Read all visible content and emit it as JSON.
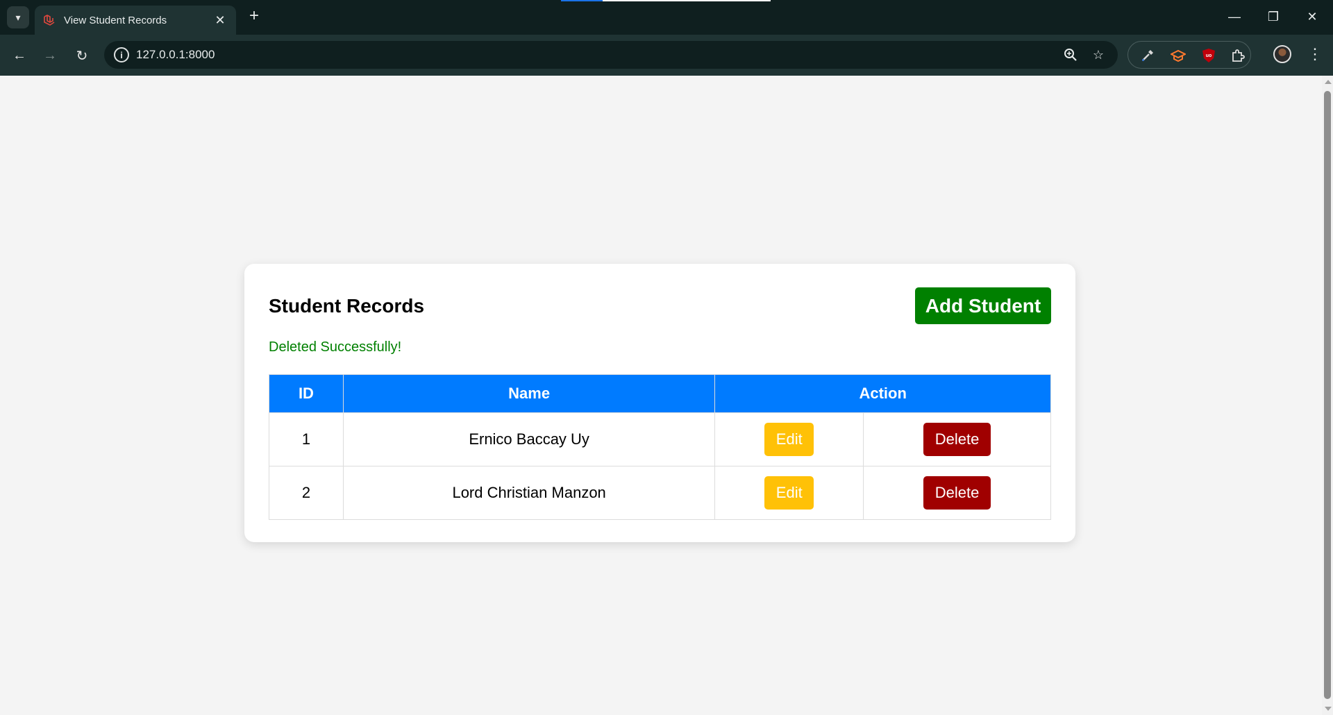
{
  "browser": {
    "tab_title": "View Student Records",
    "url": "127.0.0.1:8000",
    "icons": {
      "tab_search": "chevron-down-icon",
      "favicon": "laravel-icon",
      "tab_close": "close-icon",
      "new_tab": "plus-icon",
      "back": "arrow-left-icon",
      "forward": "arrow-right-icon",
      "reload": "reload-icon",
      "site_info": "info-icon",
      "zoom": "zoom-icon",
      "bookmark": "star-icon",
      "extensions": [
        "eyedropper-icon",
        "graduation-cap-icon",
        "ublock-icon",
        "puzzle-icon"
      ],
      "menu": "more-vertical-icon"
    }
  },
  "page": {
    "title": "Student Records",
    "add_button": "Add Student",
    "flash_message": "Deleted Successfully!",
    "colors": {
      "primary_header": "#007bff",
      "add_button": "#008000",
      "success_text": "#008000",
      "edit_button": "#ffc107",
      "delete_button": "#a00000"
    },
    "table": {
      "headers": [
        "ID",
        "Name",
        "Action"
      ],
      "rows": [
        {
          "id": "1",
          "name": "Ernico Baccay Uy",
          "edit": "Edit",
          "delete": "Delete"
        },
        {
          "id": "2",
          "name": "Lord Christian Manzon",
          "edit": "Edit",
          "delete": "Delete"
        }
      ]
    }
  }
}
